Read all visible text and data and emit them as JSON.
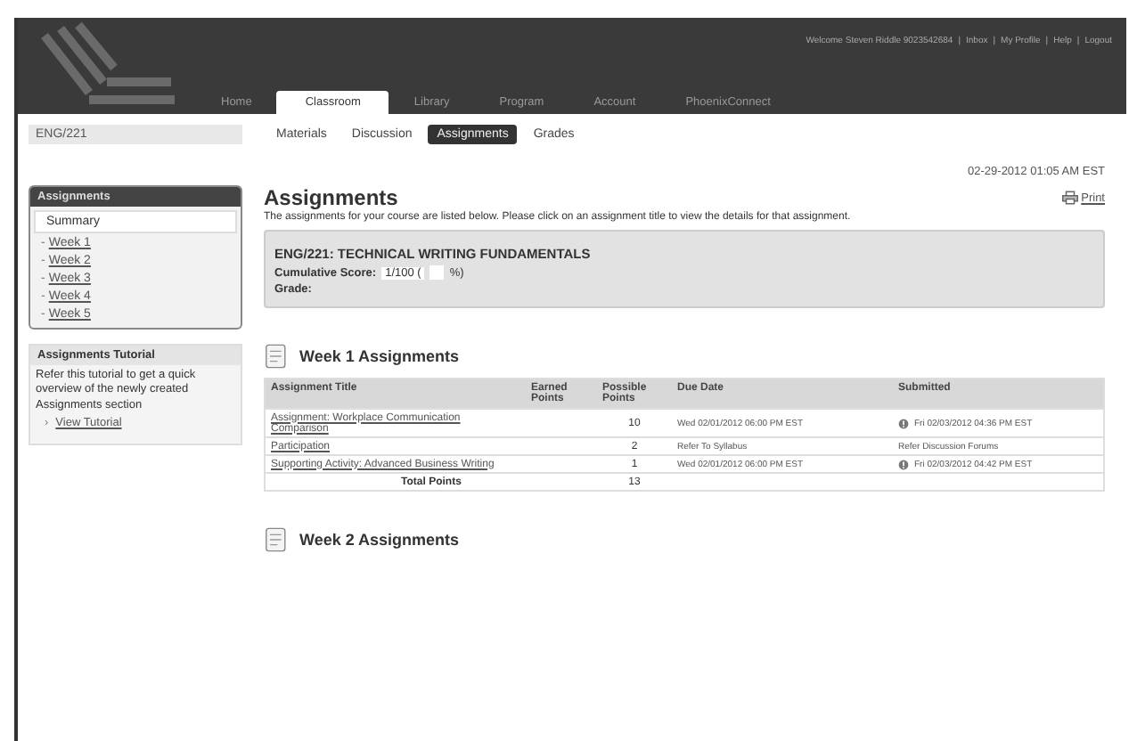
{
  "header": {
    "user_links": [
      "Welcome Steven Riddle 9023542684",
      "Inbox",
      "My Profile",
      "Help",
      "Logout"
    ],
    "separator": "|",
    "nav_tabs": [
      {
        "label": "Home",
        "selected": false
      },
      {
        "label": "Classroom",
        "selected": true
      },
      {
        "label": "Library",
        "selected": false
      },
      {
        "label": "Program",
        "selected": false
      },
      {
        "label": "Account",
        "selected": false
      },
      {
        "label": "PhoenixConnect",
        "selected": false
      }
    ]
  },
  "course": "ENG/221",
  "sub_tabs": [
    {
      "label": "Materials",
      "selected": false
    },
    {
      "label": "Discussion",
      "selected": false
    },
    {
      "label": "Assignments",
      "selected": true
    },
    {
      "label": "Grades",
      "selected": false
    }
  ],
  "datetime": "02-29-2012 01:05 AM EST",
  "sidebar": {
    "title": "Assignments",
    "bullet": "-",
    "items": [
      {
        "label": "Summary",
        "selected": true
      },
      {
        "label": "Week 1",
        "selected": false
      },
      {
        "label": "Week 2",
        "selected": false
      },
      {
        "label": "Week 3",
        "selected": false
      },
      {
        "label": "Week 4",
        "selected": false
      },
      {
        "label": "Week 5",
        "selected": false
      }
    ],
    "tutorial": {
      "title": "Assignments Tutorial",
      "text": "Refer this tutorial to get a quick overview of the newly created Assignments section",
      "link_bullet": "›",
      "link": "View Tutorial"
    }
  },
  "main": {
    "title": "Assignments",
    "print": "Print",
    "intro": "The assignments for your course are listed below. Please click on an assignment title to view the details for that assignment.",
    "course_box": {
      "heading": "ENG/221: TECHNICAL WRITING FUNDAMENTALS",
      "score_label": "Cumulative Score:",
      "score": "1/100 (",
      "score_suffix": "%)",
      "grade_label": "Grade:"
    },
    "weeks": [
      {
        "title": "Week 1 Assignments",
        "columns": [
          "Assignment Title",
          "Earned Points",
          "Possible Points",
          "Due Date",
          "Submitted"
        ],
        "rows": [
          {
            "title": "Assignment: Workplace Communication Comparison",
            "possible": "10",
            "due": "Wed 02/01/2012 06:00 PM EST",
            "submitted": "Fri 02/03/2012 04:36 PM EST",
            "late_icon": true
          },
          {
            "title": "Participation",
            "possible": "2",
            "due": "Refer To Syllabus",
            "submitted": "Refer Discussion Forums",
            "late_icon": false
          },
          {
            "title": "Supporting Activity: Advanced Business Writing",
            "possible": "1",
            "due": "Wed 02/01/2012 06:00 PM EST",
            "submitted": "Fri 02/03/2012 04:42 PM EST",
            "late_icon": true
          }
        ],
        "total_label": "Total Points",
        "total": "13"
      },
      {
        "title": "Week 2 Assignments"
      }
    ]
  }
}
